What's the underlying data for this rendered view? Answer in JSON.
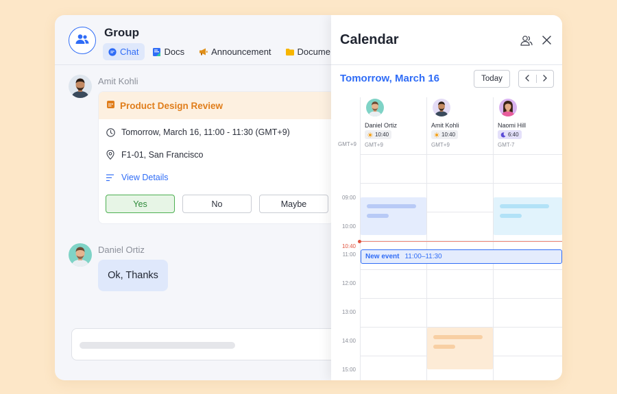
{
  "group": {
    "title": "Group",
    "tabs": [
      {
        "label": "Chat",
        "icon": "chat-bubble-icon"
      },
      {
        "label": "Docs",
        "icon": "docs-icon"
      },
      {
        "label": "Announcement",
        "icon": "megaphone-icon"
      },
      {
        "label": "Docume",
        "icon": "folder-icon"
      }
    ]
  },
  "messages": [
    {
      "sender": "Amit Kohli",
      "card": {
        "title": "Product Design Review",
        "time": "Tomorrow, March 16, 11:00 - 11:30 (GMT+9)",
        "location": "F1-01, San Francisco",
        "details_link": "View Details",
        "rsvp": {
          "yes": "Yes",
          "no": "No",
          "maybe": "Maybe"
        }
      }
    },
    {
      "sender": "Daniel Ortiz",
      "text": "Ok, Thanks"
    }
  ],
  "calendar": {
    "title": "Calendar",
    "date_label": "Tomorrow, March 16",
    "today_button": "Today",
    "gutter_timezone": "GMT+9",
    "people": [
      {
        "name": "Daniel Ortiz",
        "local_time": "10:40",
        "time_icon": "sun-icon",
        "timezone": "GMT+9"
      },
      {
        "name": "Amit Kohli",
        "local_time": "10:40",
        "time_icon": "sun-icon",
        "timezone": "GMT+9"
      },
      {
        "name": "Naomi Hill",
        "local_time": "6:40",
        "time_icon": "moon-icon",
        "timezone": "GMT-7"
      }
    ],
    "hours": [
      "09:00",
      "10:00",
      "11:00",
      "12:00",
      "13:00",
      "14:00",
      "15:00"
    ],
    "current_time": "10:40",
    "new_event": {
      "title": "New event",
      "time": "11:00–11:30"
    }
  },
  "colors": {
    "accent": "#2f6cf6",
    "card_title": "#e07d1a",
    "card_head_bg": "#fdf0e0",
    "now_line": "#e0523d",
    "event_blue": "#e4ecfd",
    "event_cyan": "#e1f3fc",
    "event_peach": "#fdebd6",
    "page_bg": "#fde7c8"
  }
}
